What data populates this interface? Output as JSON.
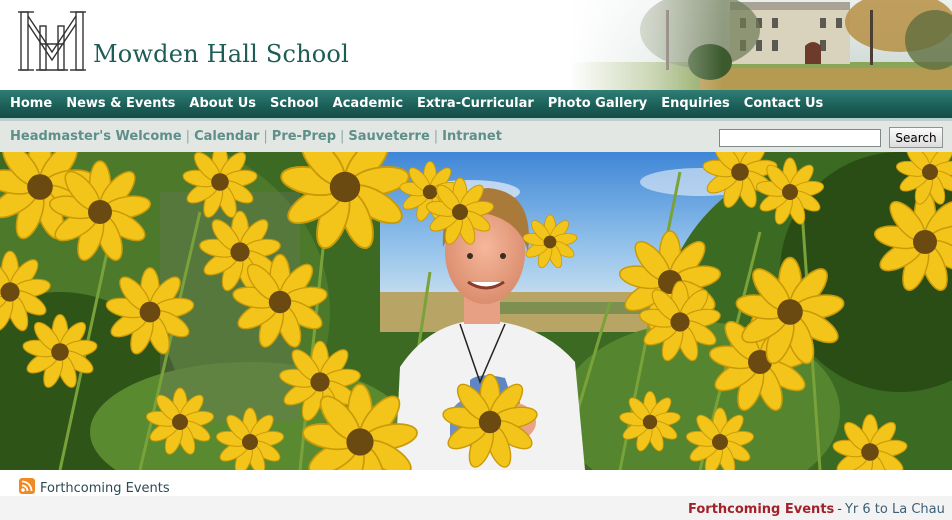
{
  "header": {
    "site_title": "Mowden Hall School"
  },
  "main_nav": {
    "items": [
      {
        "label": "Home"
      },
      {
        "label": "News & Events"
      },
      {
        "label": "About Us"
      },
      {
        "label": "School"
      },
      {
        "label": "Academic"
      },
      {
        "label": "Extra-Curricular"
      },
      {
        "label": "Photo Gallery"
      },
      {
        "label": "Enquiries"
      },
      {
        "label": "Contact Us"
      }
    ]
  },
  "sub_nav": {
    "items": [
      {
        "label": "Headmaster's Welcome"
      },
      {
        "label": "Calendar"
      },
      {
        "label": "Pre-Prep"
      },
      {
        "label": "Sauveterre"
      },
      {
        "label": "Intranet"
      }
    ],
    "separator": "|"
  },
  "search": {
    "value": "",
    "button_label": "Search"
  },
  "events": {
    "label": "Forthcoming Events"
  },
  "ticker": {
    "title": "Forthcoming Events",
    "separator": "-",
    "item": "Yr 6 to La Chau"
  },
  "colors": {
    "brand_green": "#1e5d55",
    "nav_green": "#1c6059",
    "subnav_link": "#5e8f88",
    "ticker_red": "#a3222a"
  }
}
